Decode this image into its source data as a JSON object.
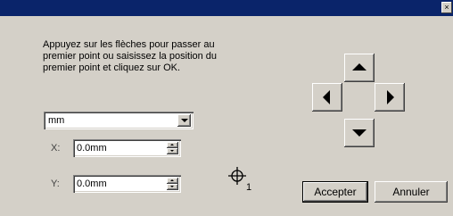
{
  "window": {
    "close_glyph": "×"
  },
  "instructions": "Appuyez sur les flèches pour passer au\npremier point ou saisissez la position du\npremier point et cliquez sur OK.",
  "unit_select": {
    "selected": "mm"
  },
  "x_field": {
    "label": "X:",
    "value": "0.0mm"
  },
  "y_field": {
    "label": "Y:",
    "value": "0.0mm"
  },
  "point_marker": {
    "icon": "crosshair-icon",
    "index": "1"
  },
  "nav_arrows": {
    "up": "arrow-up-icon",
    "down": "arrow-down-icon",
    "left": "arrow-left-icon",
    "right": "arrow-right-icon"
  },
  "buttons": {
    "accept": "Accepter",
    "cancel": "Annuler"
  },
  "colors": {
    "titlebar": "#0a246a",
    "face": "#d4d0c8"
  }
}
